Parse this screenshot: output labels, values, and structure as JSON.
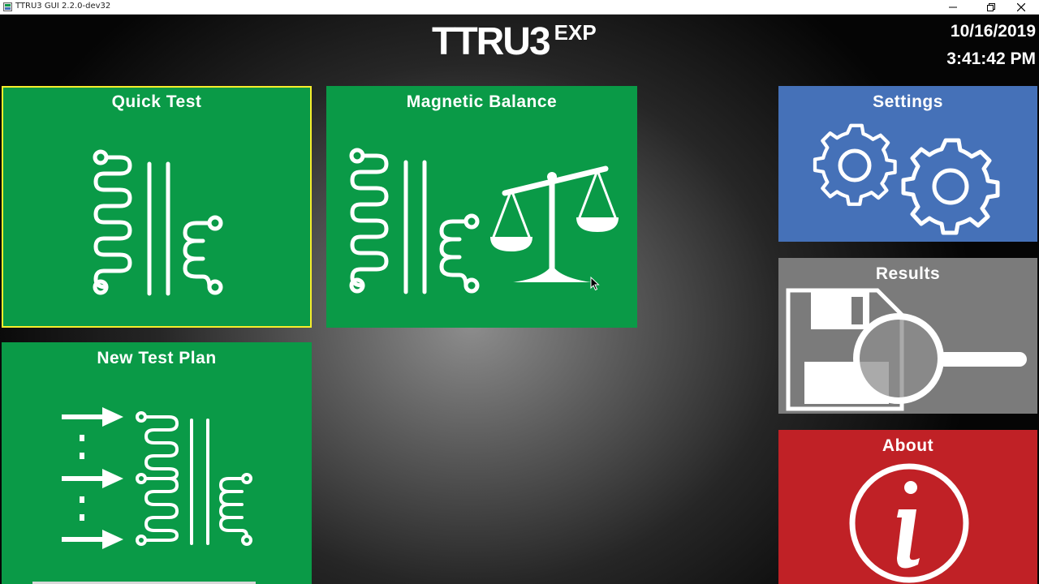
{
  "window": {
    "title": "TTRU3 GUI 2.2.0-dev32",
    "controls": [
      "minimize-icon",
      "restore-icon",
      "close-icon"
    ]
  },
  "header": {
    "logo_main": "TTRU3",
    "logo_sup": "EXP",
    "date": "10/16/2019",
    "time": "3:41:42 PM"
  },
  "tiles": {
    "quick_test": {
      "label": "Quick Test",
      "icon": "transformer-icon",
      "color": "#0a9a47",
      "selected": true
    },
    "magnetic_balance": {
      "label": "Magnetic Balance",
      "icon": "transformer-scale-icon",
      "color": "#0a9a47"
    },
    "new_test_plan": {
      "label": "New Test Plan",
      "icon": "test-plan-icon",
      "color": "#0a9a47"
    },
    "settings": {
      "label": "Settings",
      "icon": "gears-icon",
      "color": "#4571b8"
    },
    "results": {
      "label": "Results",
      "icon": "floppy-magnifier-icon",
      "color": "#7b7b7b"
    },
    "about": {
      "label": "About",
      "icon": "info-icon",
      "color": "#c02126"
    }
  },
  "colors": {
    "selection_border": "#f7ee2c"
  }
}
